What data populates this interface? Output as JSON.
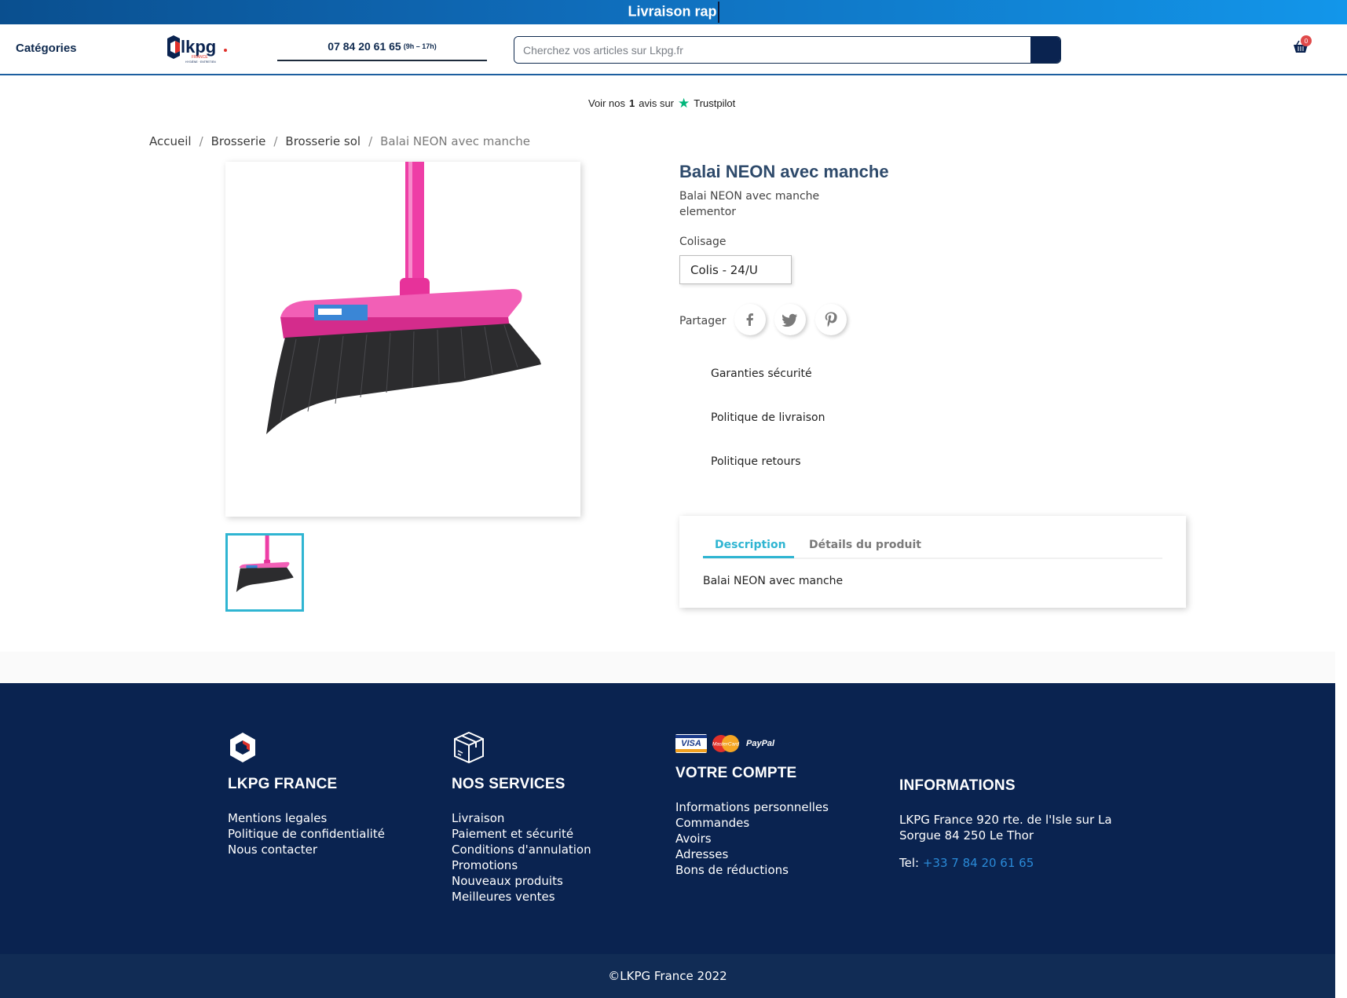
{
  "promo": {
    "text": "Livraison rap"
  },
  "header": {
    "categories_label": "Catégories",
    "logo_alt": "lkpg",
    "phone_number": "07 84 20 61 65",
    "phone_hours": "(9h – 17h)",
    "search_placeholder": "Cherchez vos articles sur Lkpg.fr",
    "cart_count": "0"
  },
  "trustpilot": {
    "prefix": "Voir nos",
    "count": "1",
    "suffix": "avis sur",
    "brand": "Trustpilot"
  },
  "breadcrumb": {
    "items": [
      "Accueil",
      "Brosserie",
      "Brosserie sol",
      "Balai NEON avec manche"
    ]
  },
  "product": {
    "title": "Balai NEON avec manche",
    "short_desc_line1": "Balai NEON avec manche",
    "short_desc_line2": "elementor",
    "colisage_label": "Colisage",
    "colisage_value": "Colis - 24/U",
    "share_label": "Partager",
    "reassurance": [
      "Garanties sécurité",
      "Politique de livraison",
      "Politique retours"
    ],
    "tabs": [
      "Description",
      "Détails du produit"
    ],
    "description": "Balai NEON avec manche"
  },
  "footer": {
    "col1": {
      "title": "LKPG FRANCE",
      "links": [
        "Mentions legales",
        "Politique de confidentialité",
        "Nous contacter"
      ]
    },
    "col2": {
      "title": "NOS SERVICES",
      "links": [
        "Livraison",
        "Paiement et sécurité",
        "Conditions d'annulation",
        "Promotions",
        "Nouveaux produits",
        "Meilleures ventes"
      ]
    },
    "col3": {
      "title": "VOTRE COMPTE",
      "links": [
        "Informations personnelles",
        "Commandes",
        "Avoirs",
        "Adresses",
        "Bons de réductions"
      ],
      "payment_labels": [
        "VISA",
        "MasterCard",
        "PayPal"
      ]
    },
    "col4": {
      "title": "INFORMATIONS",
      "address": "LKPG France 920 rte. de l'Isle sur La Sorgue 84 250 Le Thor",
      "tel_label": "Tel:",
      "tel_value": "+33 7 84 20 61 65"
    },
    "copyright": "©LKPG France 2022"
  },
  "colors": {
    "primary_navy": "#0a2350",
    "accent_cyan": "#2fb5d2",
    "brand_red": "#e0302a",
    "broom_pink": "#ee3ea6"
  }
}
